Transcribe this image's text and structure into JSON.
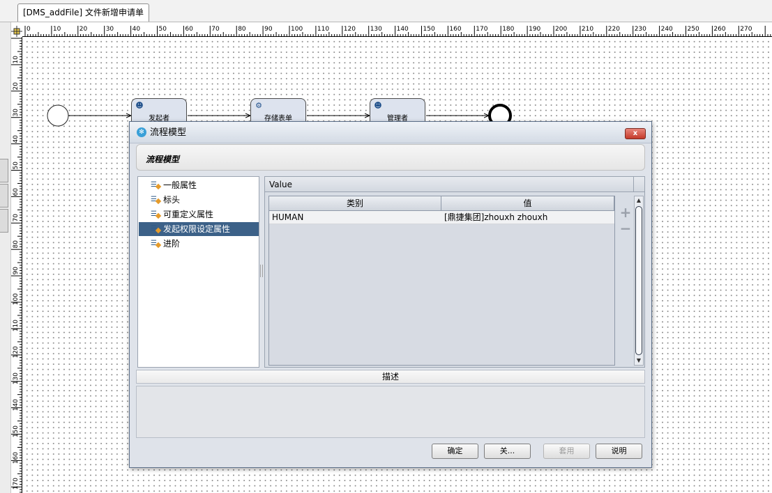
{
  "editor_tab": {
    "title": "[DMS_addFile] 文件新增申请单"
  },
  "ruler": {
    "h_labels": [
      "0",
      "10",
      "20",
      "30",
      "40",
      "50",
      "60",
      "70",
      "80",
      "90",
      "100",
      "110",
      "120",
      "130",
      "140",
      "150",
      "160",
      "170",
      "180",
      "190",
      "200",
      "210",
      "220",
      "230",
      "240",
      "250",
      "260",
      "270"
    ],
    "v_labels": [
      "10",
      "20",
      "30",
      "40",
      "50",
      "60",
      "70",
      "80",
      "90",
      "100",
      "110",
      "120",
      "130",
      "140",
      "150",
      "160",
      "170"
    ]
  },
  "workflow": {
    "nodes": [
      {
        "label": "发起者",
        "icon": "user-icon"
      },
      {
        "label": "存储表单",
        "icon": "gear-icon"
      },
      {
        "label": "管理者",
        "icon": "user-icon"
      }
    ]
  },
  "dialog": {
    "title": "流程模型",
    "close_label": "x",
    "header_title": "流程模型",
    "tree": {
      "items": [
        {
          "label": "一般属性",
          "selected": false
        },
        {
          "label": "标头",
          "selected": false
        },
        {
          "label": "可重定义属性",
          "selected": false
        },
        {
          "label": "发起权限设定属性",
          "selected": true
        },
        {
          "label": "进阶",
          "selected": false
        }
      ]
    },
    "value_panel": {
      "title": "Value",
      "columns": [
        "类别",
        "值"
      ],
      "rows": [
        {
          "category": "HUMAN",
          "value": "[鼎捷集团]zhouxh zhouxh"
        }
      ],
      "add_label": "+",
      "remove_label": "−"
    },
    "description_label": "描述",
    "buttons": {
      "ok": "确定",
      "close": "关...",
      "apply": "套用",
      "help": "说明"
    }
  }
}
